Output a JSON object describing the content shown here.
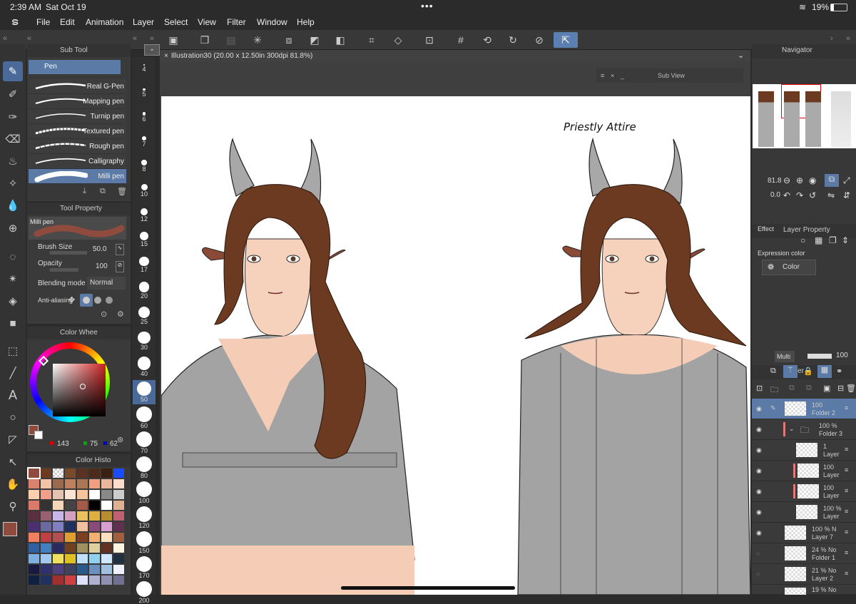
{
  "status": {
    "time": "2:39 AM",
    "date": "Sat Oct 19",
    "battery": "19%"
  },
  "menu": [
    "File",
    "Edit",
    "Animation",
    "Layer",
    "Select",
    "View",
    "Filter",
    "Window",
    "Help"
  ],
  "document_tab": "Illustration30 (20.00 x 12.50in 300dpi 81.8%)",
  "subview_title": "Sub View",
  "subtool": {
    "header": "Sub Tool",
    "group": "Pen",
    "brushes": [
      "Real G-Pen",
      "Mapping pen",
      "Turnip pen",
      "Textured pen",
      "Rough pen",
      "Calligraphy",
      "Milli pen"
    ],
    "selected": "Milli pen"
  },
  "tool_property": {
    "header": "Tool Property",
    "brush": "Milli pen",
    "brush_size_label": "Brush Size",
    "brush_size": "50.0",
    "opacity_label": "Opacity",
    "opacity": "100",
    "blending_label": "Blending mode",
    "blending": "Normal",
    "antialias_label": "Anti-aliasing"
  },
  "color_wheel": {
    "header": "Color Whee",
    "r": "143",
    "g": "75",
    "b": "62",
    "current": "#8f4b3e"
  },
  "color_history": {
    "header": "Color Histo"
  },
  "brush_sizes": [
    "4",
    "5",
    "6",
    "7",
    "8",
    "10",
    "12",
    "15",
    "17",
    "20",
    "25",
    "30",
    "40",
    "50",
    "60",
    "70",
    "80",
    "100",
    "120",
    "150",
    "170",
    "200"
  ],
  "navigator": {
    "header": "Navigator",
    "zoom": "81.8",
    "rotate": "0.0"
  },
  "layer_property": {
    "header": "Layer Property",
    "effect_label": "Effect",
    "expression_label": "Expression color",
    "expression_value": "Color"
  },
  "layer_panel": {
    "header": "Layer",
    "blend": "Multi",
    "opacity": "100"
  },
  "layers": [
    {
      "pct": "100",
      "name": "Folder 2"
    },
    {
      "pct": "100 %",
      "name": "Folder 3"
    },
    {
      "pct": "1",
      "name": "Layer"
    },
    {
      "pct": "100",
      "name": "Layer"
    },
    {
      "pct": "100",
      "name": "Layer"
    },
    {
      "pct": "100 %",
      "name": "Layer"
    },
    {
      "pct": "100 % N",
      "name": "Layer 7"
    },
    {
      "pct": "24 % No",
      "name": "Folder 1"
    },
    {
      "pct": "21 % No",
      "name": "Layer 2"
    },
    {
      "pct": "19 % No",
      "name": ""
    }
  ],
  "canvas_text": "Priestly Attire"
}
